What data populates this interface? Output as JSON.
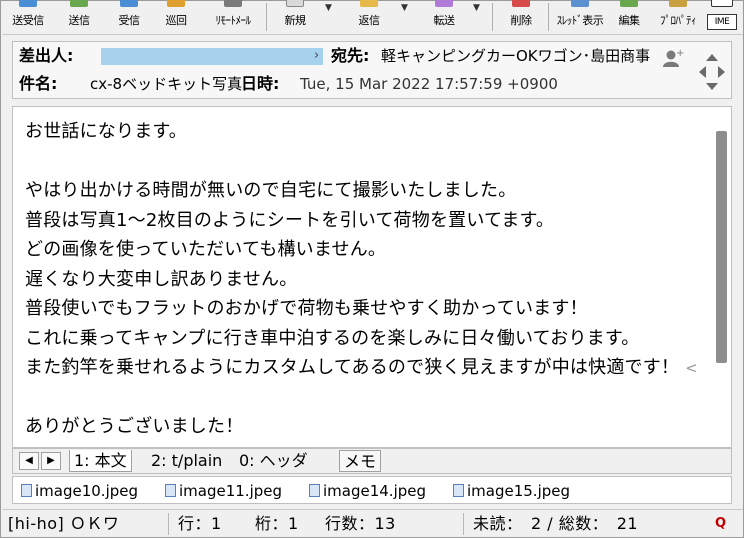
{
  "toolbar": {
    "buttons": [
      {
        "label": "送受信",
        "icon": "send-receive-icon"
      },
      {
        "label": "送信",
        "icon": "send-icon"
      },
      {
        "label": "受信",
        "icon": "receive-icon"
      },
      {
        "label": "巡回",
        "icon": "patrol-icon"
      },
      {
        "label": "ﾘﾓｰﾄﾒｰﾙ",
        "icon": "remote-mail-icon"
      },
      {
        "label": "新規",
        "icon": "new-message-icon"
      },
      {
        "label": "返信",
        "icon": "reply-icon"
      },
      {
        "label": "転送",
        "icon": "forward-icon"
      },
      {
        "label": "削除",
        "icon": "delete-icon"
      },
      {
        "label": "ｽﾚｯﾄﾞ表示",
        "icon": "thread-view-icon"
      },
      {
        "label": "編集",
        "icon": "edit-icon"
      },
      {
        "label": "ﾌﾟﾛﾊﾟﾃｨ",
        "icon": "properties-icon"
      },
      {
        "label": "IME",
        "icon": "ime-icon"
      }
    ],
    "accent": "#2b6cb0"
  },
  "header": {
    "from_label": "差出人:",
    "from_chevron": "›",
    "to_label": "宛先:",
    "to_value": "軽キャンピングカーOKワゴン･島田商事",
    "subject_label": "件名:",
    "subject_value": "cx-8ベッドキット写真",
    "date_label": "日時:",
    "date_value": "Tue, 15 Mar 2022 17:57:59 +0900",
    "redaction_color": "#a6d2ee"
  },
  "body": {
    "lines": [
      "お世話になります。",
      "",
      "やはり出かける時間が無いので自宅にて撮影いたしました。",
      "普段は写真1～2枚目のようにシートを引いて荷物を置いてます。",
      "どの画像を使っていただいても構いません。",
      "遅くなり大変申し訳ありません。",
      "普段使いでもフラットのおかげで荷物も乗せやすく助かっています！",
      "これに乗ってキャンプに行き車中泊するのを楽しみに日々働いております。",
      "また釣竿を乗せれるようにカスタムしてあるので狭く見えますが中は快適です！",
      "",
      "ありがとうございました！"
    ],
    "overflow_mark": "<"
  },
  "tabs": {
    "prev_arrow": "◀",
    "next_arrow": "▶",
    "items": [
      "1: 本文",
      "2: t/plain",
      "0: ヘッダ"
    ],
    "memo": "メモ"
  },
  "attachments": [
    "image10.jpeg",
    "image11.jpeg",
    "image14.jpeg",
    "image15.jpeg"
  ],
  "status": {
    "account": "[hi-ho] ＯＫワ",
    "row": "行：1",
    "col": "桁：1",
    "lines": "行数：13",
    "unread": "未読：　2 / 総数：　21",
    "logo": "Q"
  }
}
